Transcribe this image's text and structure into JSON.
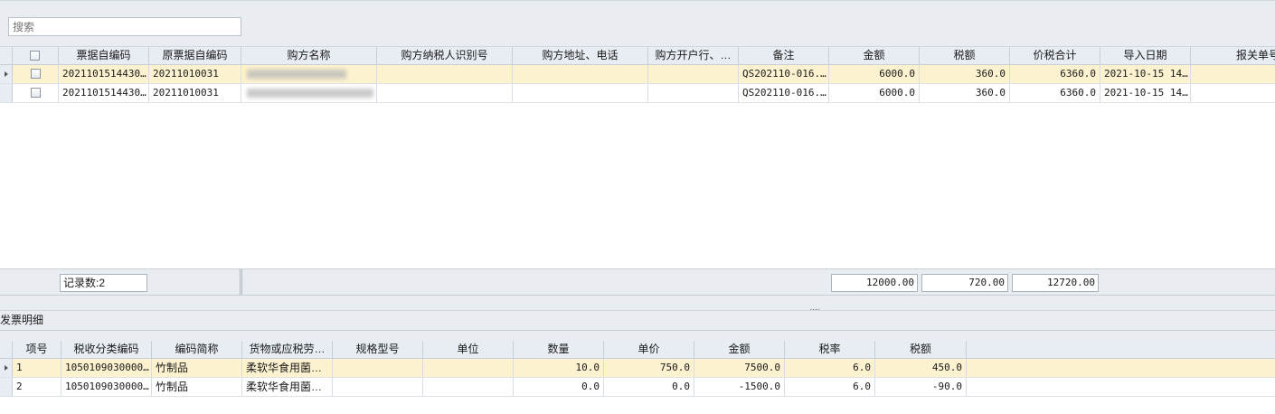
{
  "search": {
    "placeholder": "搜索"
  },
  "invoices": {
    "headers": [
      "票据自编码",
      "原票据自编码",
      "购方名称",
      "购方纳税人识别号",
      "购方地址、电话",
      "购方开户行、…",
      "备注",
      "金额",
      "税额",
      "价税合计",
      "导入日期",
      "报关单号"
    ],
    "rows": [
      {
        "code": "2021101514430…",
        "orig_code": "20211010031",
        "buyer": "",
        "tax_id": "",
        "address": "",
        "bank": "",
        "note": "QS202110-016.…",
        "amount": "6000.0",
        "tax": "360.0",
        "total": "6360.0",
        "import_date": "2021-10-15 14…",
        "customs_no": ""
      },
      {
        "code": "2021101514430…",
        "orig_code": "20211010031",
        "buyer": "",
        "tax_id": "",
        "address": "",
        "bank": "",
        "note": "QS202110-016.…",
        "amount": "6000.0",
        "tax": "360.0",
        "total": "6360.0",
        "import_date": "2021-10-15 14…",
        "customs_no": ""
      }
    ],
    "record_count": "记录数:2",
    "sum_amount": "12000.00",
    "sum_tax": "720.00",
    "sum_total": "12720.00"
  },
  "splitter": {
    "grip": "...."
  },
  "details": {
    "title": "发票明细",
    "headers": [
      "项号",
      "税收分类编码",
      "编码简称",
      "货物或应税劳…",
      "规格型号",
      "单位",
      "数量",
      "单价",
      "金额",
      "税率",
      "税额"
    ],
    "rows": [
      {
        "no": "1",
        "tax_code": "1050109030000…",
        "short_name": "竹制品",
        "goods": "柔软华食用菌…",
        "spec": "",
        "unit": "",
        "qty": "10.0",
        "price": "750.0",
        "amount": "7500.0",
        "rate": "6.0",
        "tax": "450.0"
      },
      {
        "no": "2",
        "tax_code": "1050109030000…",
        "short_name": "竹制品",
        "goods": "柔软华食用菌…",
        "spec": "",
        "unit": "",
        "qty": "0.0",
        "price": "0.0",
        "amount": "-1500.0",
        "rate": "6.0",
        "tax": "-90.0"
      }
    ]
  }
}
